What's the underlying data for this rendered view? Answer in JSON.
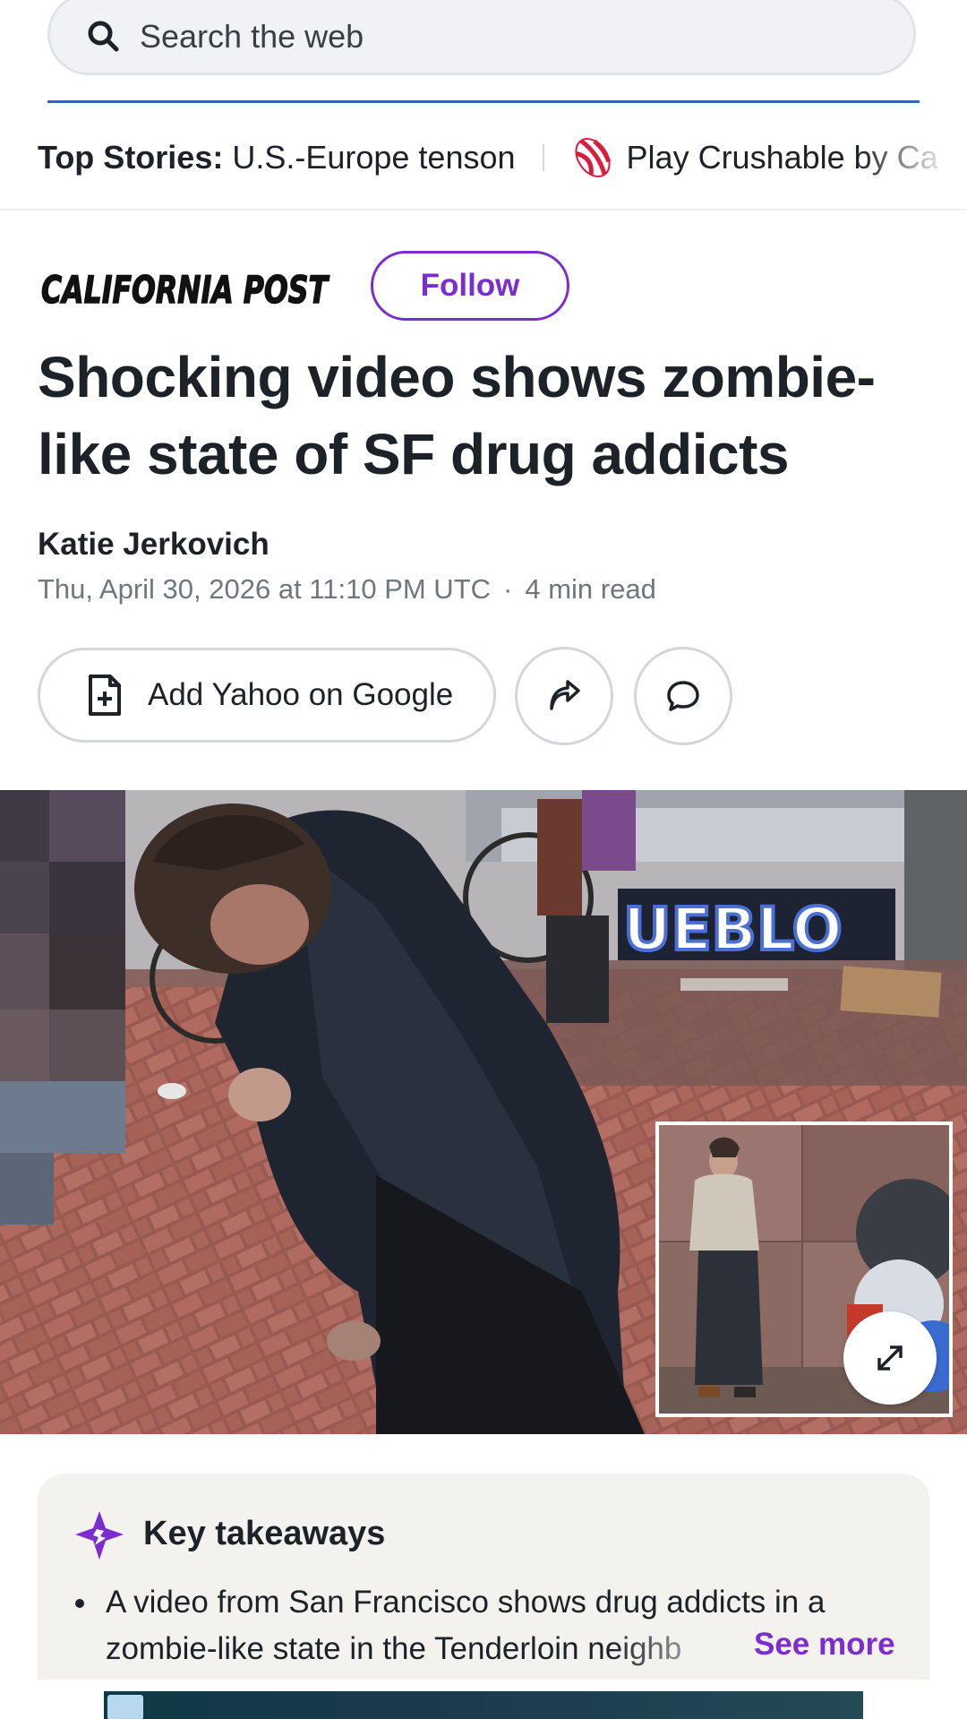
{
  "search": {
    "placeholder": "Search the web"
  },
  "ticker": {
    "label": "Top Stories:",
    "story": "U.S.-Europe tenson",
    "ad": "Play Crushable by Ca"
  },
  "publisher": {
    "name": "CALIFORNIA POST",
    "follow_label": "Follow"
  },
  "article": {
    "headline": "Shocking video shows zombie-like state of SF drug addicts",
    "author": "Katie Jerkovich",
    "date": "Thu, April 30, 2026 at 11:10 PM UTC",
    "read_time": "4 min read",
    "separator": "·"
  },
  "actions": {
    "add_yahoo_label": "Add Yahoo on Google"
  },
  "hero": {
    "graffiti_text": "UEBLO"
  },
  "takeaways": {
    "title": "Key takeaways",
    "items": [
      "A video from San Francisco shows drug addicts in a zombie-like state in the Tenderloin neighb"
    ],
    "see_more": "See more"
  },
  "colors": {
    "accent": "#7b2dd0",
    "search_underline": "#3a64a8",
    "text": "#1d2228",
    "meta": "#6e7780"
  }
}
